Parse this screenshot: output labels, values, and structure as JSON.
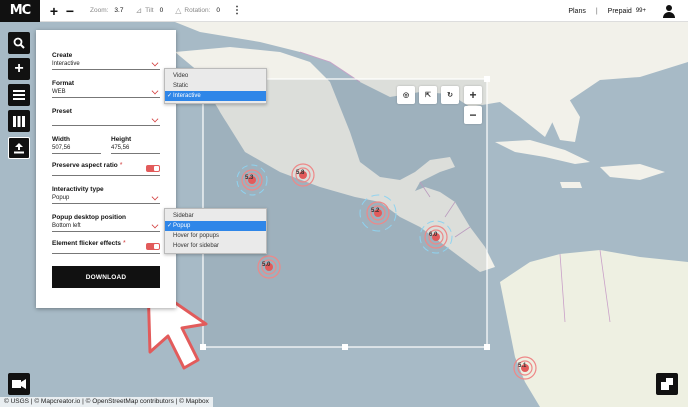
{
  "app": {
    "logo_text": "MC"
  },
  "toolbar": {
    "zoom_label": "Zoom:",
    "zoom_value": "3.7",
    "tilt_label": "Tilt",
    "tilt_value": "0",
    "rotation_label": "Rotation:",
    "rotation_value": "0",
    "plans_label": "Plans",
    "separator": "|",
    "prepaid_label": "Prepaid",
    "prepaid_value": "99+"
  },
  "panel": {
    "create_label": "Create",
    "create_value": "Interactive",
    "format_label": "Format",
    "format_value": "WEB",
    "preset_label": "Preset",
    "preset_value": "",
    "width_label": "Width",
    "width_value": "507,56",
    "height_label": "Height",
    "height_value": "475,56",
    "aspect_label": "Preserve aspect ratio",
    "aspect_req": "*",
    "aspect_on": true,
    "interactivity_label": "Interactivity type",
    "interactivity_value": "Popup",
    "popup_label": "Popup desktop position",
    "popup_value": "Bottom left",
    "flicker_label": "Element flicker effects",
    "flicker_req": "*",
    "flicker_on": true,
    "download_label": "DOWNLOAD"
  },
  "create_dropdown": {
    "options": [
      "Video",
      "Static",
      "Interactive"
    ],
    "selected": "Interactive"
  },
  "interactivity_dropdown": {
    "options": [
      "Sidebar",
      "Popup",
      "Hover for popups",
      "Hover for sidebar"
    ],
    "selected": "Popup"
  },
  "icons": {
    "search": "search-icon",
    "add": "plus-icon",
    "menu": "menu-icon",
    "library": "library-icon",
    "export": "export-icon",
    "video": "video-camera-icon",
    "minimap": "minimap-icon",
    "gps": "gps-icon",
    "fit": "fit-frame-icon",
    "reset": "reset-rotation-icon",
    "zoom_in": "zoom-in-icon",
    "zoom_out": "zoom-out-icon"
  },
  "map": {
    "attribution": "© USGS | © Mapcreator.io | © OpenStreetMap contributors | © Mapbox",
    "markers": [
      "5.3",
      "5.8",
      "5.2",
      "6.0",
      "5.0",
      "5.1"
    ],
    "colors": {
      "water": "#a7bac6",
      "land": "#f2f1ea",
      "border": "#c9a0c8",
      "accent": "#e25b5b"
    }
  }
}
